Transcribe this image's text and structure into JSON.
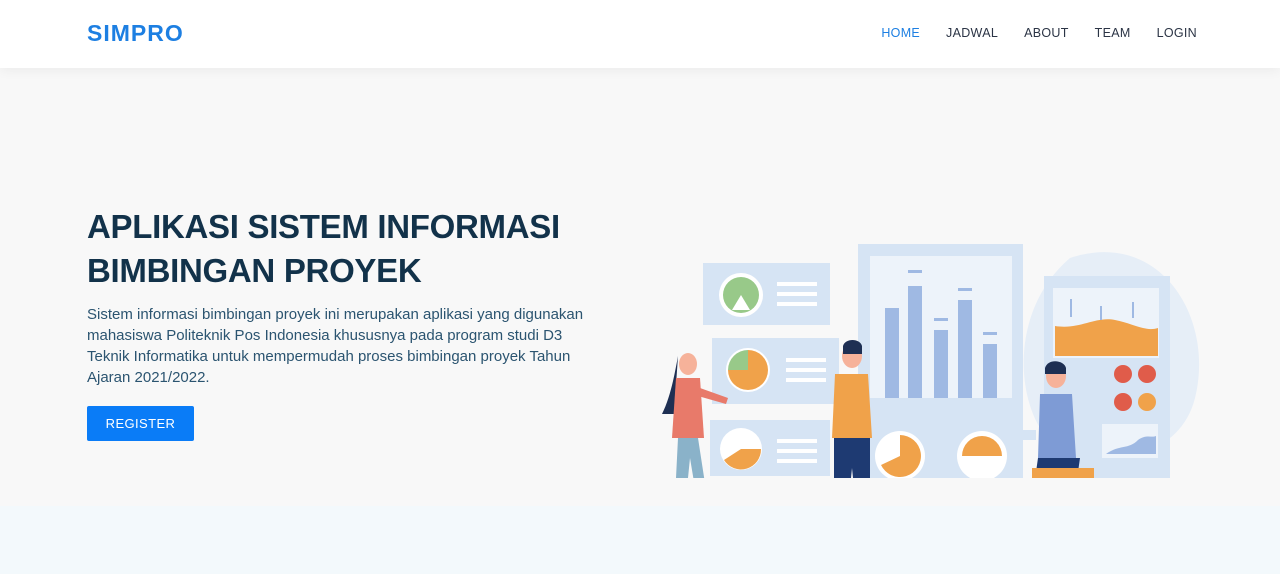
{
  "brand": "SIMPRO",
  "nav": {
    "items": [
      {
        "label": "HOME",
        "active": true
      },
      {
        "label": "JADWAL",
        "active": false
      },
      {
        "label": "ABOUT",
        "active": false
      },
      {
        "label": "TEAM",
        "active": false
      },
      {
        "label": "LOGIN",
        "active": false
      }
    ]
  },
  "hero": {
    "title_line1": "APLIKASI SISTEM INFORMASI",
    "title_line2": "BIMBINGAN PROYEK",
    "description": "Sistem informasi bimbingan proyek ini merupakan aplikasi yang digunakan mahasiswa Politeknik Pos Indonesia khususnya pada program studi D3 Teknik Informatika untuk mempermudah proses bimbingan proyek Tahun Ajaran 2021/2022.",
    "register_label": "REGISTER",
    "illustration": "presentation-illustration"
  },
  "colors": {
    "accent": "#1d7fe2",
    "button": "#0a7cf7",
    "title": "#12324a",
    "text": "#2b5470",
    "hero_bg": "#f8f8f8",
    "band_bg": "#f3f9fc"
  }
}
